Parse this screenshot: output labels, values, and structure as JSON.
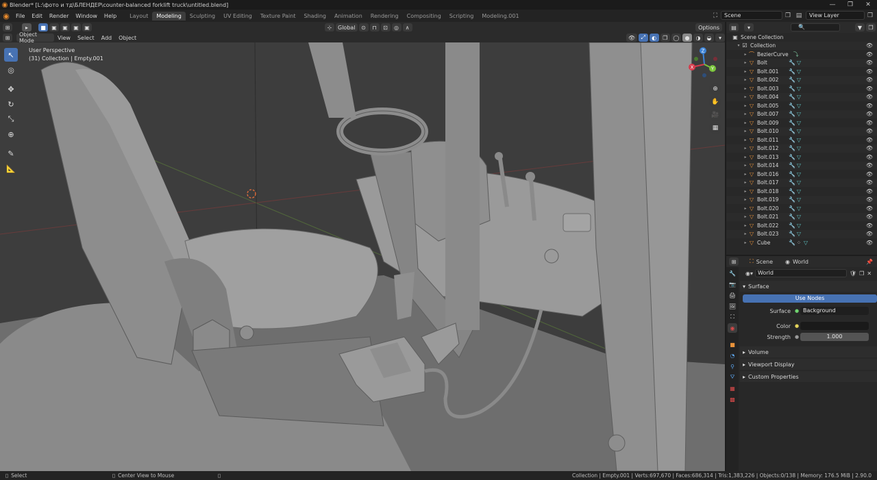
{
  "titlebar": {
    "title": "Blender* [L:\\фото и тд\\БЛЕНДЕР\\counter-balanced forklift truck\\untitled.blend]"
  },
  "menubar": {
    "items": [
      "File",
      "Edit",
      "Render",
      "Window",
      "Help"
    ],
    "workspaces": [
      "Layout",
      "Modeling",
      "Sculpting",
      "UV Editing",
      "Texture Paint",
      "Shading",
      "Animation",
      "Rendering",
      "Compositing",
      "Scripting",
      "Modeling.001"
    ],
    "active_workspace": "Modeling",
    "scene": "Scene",
    "view_layer": "View Layer"
  },
  "viewport_header": {
    "transform_orientation": "Global",
    "options_label": "Options",
    "mode": "Object Mode",
    "menus": [
      "View",
      "Select",
      "Add",
      "Object"
    ]
  },
  "viewport": {
    "perspective": "User Perspective",
    "context": "(31) Collection | Empty.001",
    "gizmo_axes": [
      "X",
      "Y",
      "Z"
    ]
  },
  "outliner": {
    "root": "Scene Collection",
    "collection": "Collection",
    "items": [
      "BezierCurve",
      "Bolt",
      "Bolt.001",
      "Bolt.002",
      "Bolt.003",
      "Bolt.004",
      "Bolt.005",
      "Bolt.007",
      "Bolt.009",
      "Bolt.010",
      "Bolt.011",
      "Bolt.012",
      "Bolt.013",
      "Bolt.014",
      "Bolt.016",
      "Bolt.017",
      "Bolt.018",
      "Bolt.019",
      "Bolt.020",
      "Bolt.021",
      "Bolt.022",
      "Bolt.023",
      "Cube"
    ]
  },
  "properties": {
    "breadcrumb_scene": "Scene",
    "breadcrumb_world": "World",
    "world_name": "World",
    "surface_label": "Surface",
    "use_nodes_label": "Use Nodes",
    "surface_field_label": "Surface",
    "surface_value": "Background",
    "color_label": "Color",
    "strength_label": "Strength",
    "strength_value": "1.000",
    "panels": [
      "Volume",
      "Viewport Display",
      "Custom Properties"
    ]
  },
  "statusbar": {
    "select": "Select",
    "center_view": "Center View to Mouse",
    "stats": "Collection | Empty.001 | Verts:697,670 | Faces:686,314 | Tris:1,383,226 | Objects:0/138 | Memory: 176.5 MiB | 2.90.0"
  },
  "colors": {
    "accent": "#4772b3",
    "object_orange": "#e8923a",
    "viewport_bg": "#3d3d3d"
  }
}
